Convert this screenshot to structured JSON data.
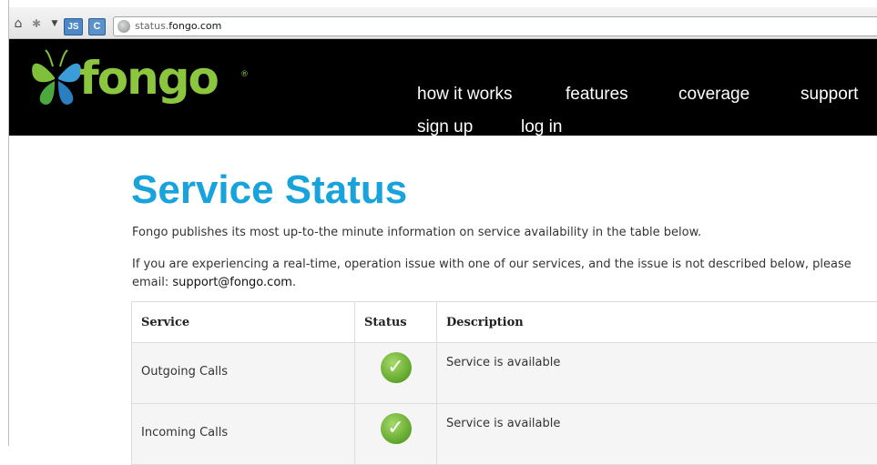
{
  "browser": {
    "js_label": "JS",
    "c_label": "C",
    "url_prefix": "status.",
    "url_domain": "fongo.com"
  },
  "site": {
    "logo_text": "fongo",
    "logo_reg": "®",
    "nav": {
      "how_it_works": "how it works",
      "features": "features",
      "coverage": "coverage",
      "support": "support",
      "sign_up": "sign up",
      "log_in": "log in"
    }
  },
  "content": {
    "title": "Service Status",
    "intro": "Fongo publishes its most up-to-the minute information on service availability in the table below.",
    "issue_text": "If you are experiencing a real-time, operation issue with one of our services, and the issue is not described below, please email: ",
    "email": "support@fongo.com",
    "email_suffix": "."
  },
  "table": {
    "headers": [
      "Service",
      "Status",
      "Description"
    ],
    "rows": [
      {
        "service": "Outgoing Calls",
        "status_icon": "check-icon",
        "description": "Service is available"
      },
      {
        "service": "Incoming Calls",
        "status_icon": "check-icon",
        "description": "Service is available"
      }
    ]
  },
  "colors": {
    "title": "#19a3dc",
    "header_bg": "#000000",
    "logo_green": "#8cc63f",
    "status_ok": "#5fa52b"
  }
}
